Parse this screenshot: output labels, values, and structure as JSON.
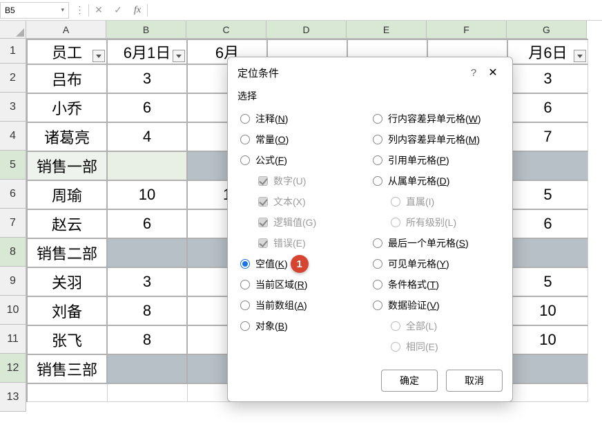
{
  "formula_bar": {
    "namebox": "B5",
    "cancel_glyph": "✕",
    "enter_glyph": "✓",
    "fx_glyph": "fx"
  },
  "columns": [
    "A",
    "B",
    "C",
    "D",
    "E",
    "F",
    "G"
  ],
  "row_numbers": [
    "1",
    "2",
    "3",
    "4",
    "5",
    "6",
    "7",
    "8",
    "9",
    "10",
    "11",
    "12",
    "13"
  ],
  "header_row": [
    "员工",
    "6月1日",
    "6月",
    "",
    "",
    "",
    "月6日"
  ],
  "rows": [
    [
      "吕布",
      "3",
      "",
      "",
      "",
      "",
      "3"
    ],
    [
      "小乔",
      "6",
      "",
      "",
      "",
      "",
      "6"
    ],
    [
      "诸葛亮",
      "4",
      "",
      "",
      "",
      "",
      "7"
    ],
    [
      "销售一部",
      "",
      "",
      "",
      "",
      "",
      ""
    ],
    [
      "周瑜",
      "10",
      "1",
      "",
      "",
      "",
      "5"
    ],
    [
      "赵云",
      "6",
      "",
      "",
      "",
      "",
      "6"
    ],
    [
      "销售二部",
      "",
      "",
      "",
      "",
      "",
      ""
    ],
    [
      "关羽",
      "3",
      "",
      "",
      "",
      "",
      "5"
    ],
    [
      "刘备",
      "8",
      "",
      "",
      "",
      "",
      "10"
    ],
    [
      "张飞",
      "8",
      "",
      "",
      "",
      "",
      "10"
    ],
    [
      "销售三部",
      "",
      "",
      "",
      "",
      "",
      ""
    ]
  ],
  "grey_rows": [
    4,
    7,
    11
  ],
  "dialog": {
    "title": "定位条件",
    "help": "?",
    "close": "✕",
    "section": "选择",
    "left": [
      {
        "kind": "radio",
        "label": "注释(",
        "u": "N",
        "tail": ")"
      },
      {
        "kind": "radio",
        "label": "常量(",
        "u": "O",
        "tail": ")"
      },
      {
        "kind": "radio",
        "label": "公式(",
        "u": "F",
        "tail": ")"
      },
      {
        "kind": "check",
        "indent": true,
        "label": "数字(U)"
      },
      {
        "kind": "check",
        "indent": true,
        "label": "文本(X)"
      },
      {
        "kind": "check",
        "indent": true,
        "label": "逻辑值(G)"
      },
      {
        "kind": "check",
        "indent": true,
        "label": "错误(E)"
      },
      {
        "kind": "radio",
        "selected": true,
        "label": "空值(",
        "u": "K",
        "tail": ")",
        "badge": "1"
      },
      {
        "kind": "radio",
        "label": "当前区域(",
        "u": "R",
        "tail": ")"
      },
      {
        "kind": "radio",
        "label": "当前数组(",
        "u": "A",
        "tail": ")"
      },
      {
        "kind": "radio",
        "label": "对象(",
        "u": "B",
        "tail": ")"
      }
    ],
    "right": [
      {
        "kind": "radio",
        "label": "行内容差异单元格(",
        "u": "W",
        "tail": ")"
      },
      {
        "kind": "radio",
        "label": "列内容差异单元格(",
        "u": "M",
        "tail": ")"
      },
      {
        "kind": "radio",
        "label": "引用单元格(",
        "u": "P",
        "tail": ")"
      },
      {
        "kind": "radio",
        "label": "从属单元格(",
        "u": "D",
        "tail": ")"
      },
      {
        "kind": "radio",
        "indent": true,
        "disabled": true,
        "label": "直属(I)"
      },
      {
        "kind": "radio",
        "indent": true,
        "disabled": true,
        "label": "所有级别(L)"
      },
      {
        "kind": "radio",
        "label": "最后一个单元格(",
        "u": "S",
        "tail": ")"
      },
      {
        "kind": "radio",
        "label": "可见单元格(",
        "u": "Y",
        "tail": ")"
      },
      {
        "kind": "radio",
        "label": "条件格式(",
        "u": "T",
        "tail": ")"
      },
      {
        "kind": "radio",
        "label": "数据验证(",
        "u": "V",
        "tail": ")"
      },
      {
        "kind": "radio",
        "indent": true,
        "disabled": true,
        "label": "全部(L)"
      },
      {
        "kind": "radio",
        "indent": true,
        "disabled": true,
        "label": "相同(E)"
      }
    ],
    "ok": "确定",
    "cancel": "取消"
  }
}
